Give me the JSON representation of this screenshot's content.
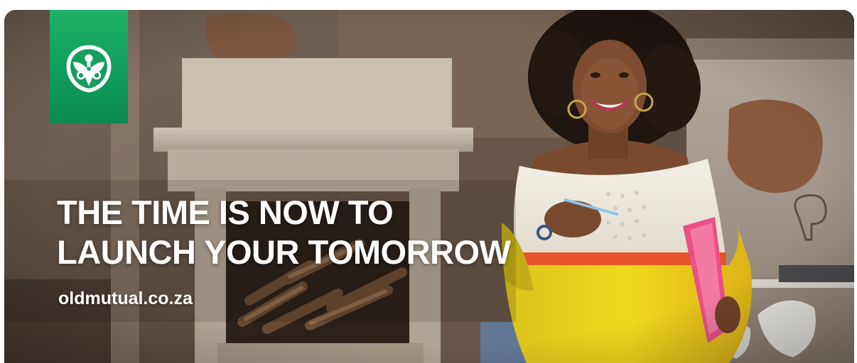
{
  "banner": {
    "headline_line1": "THE TIME IS NOW TO",
    "headline_line2": "LAUNCH YOUR TOMORROW",
    "website": "oldmutual.co.za",
    "logo_icon": "old-mutual-shield-icon",
    "colors": {
      "brand_green": "#0f9b59",
      "text": "#ffffff"
    }
  }
}
